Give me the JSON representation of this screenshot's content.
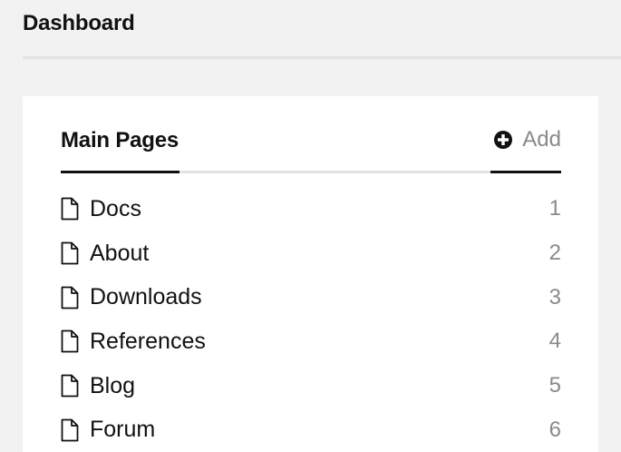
{
  "header": {
    "title": "Dashboard"
  },
  "panel": {
    "title": "Main Pages",
    "add_label": "Add",
    "items": [
      {
        "label": "Docs",
        "count": "1"
      },
      {
        "label": "About",
        "count": "2"
      },
      {
        "label": "Downloads",
        "count": "3"
      },
      {
        "label": "References",
        "count": "4"
      },
      {
        "label": "Blog",
        "count": "5"
      },
      {
        "label": "Forum",
        "count": "6"
      }
    ]
  },
  "icons": {
    "add": "plus-circle-icon",
    "page": "document-icon"
  },
  "colors": {
    "background": "#f2f2f2",
    "panel": "#ffffff",
    "text": "#111111",
    "muted": "#8a8a8a",
    "divider": "#e2e2e2"
  }
}
